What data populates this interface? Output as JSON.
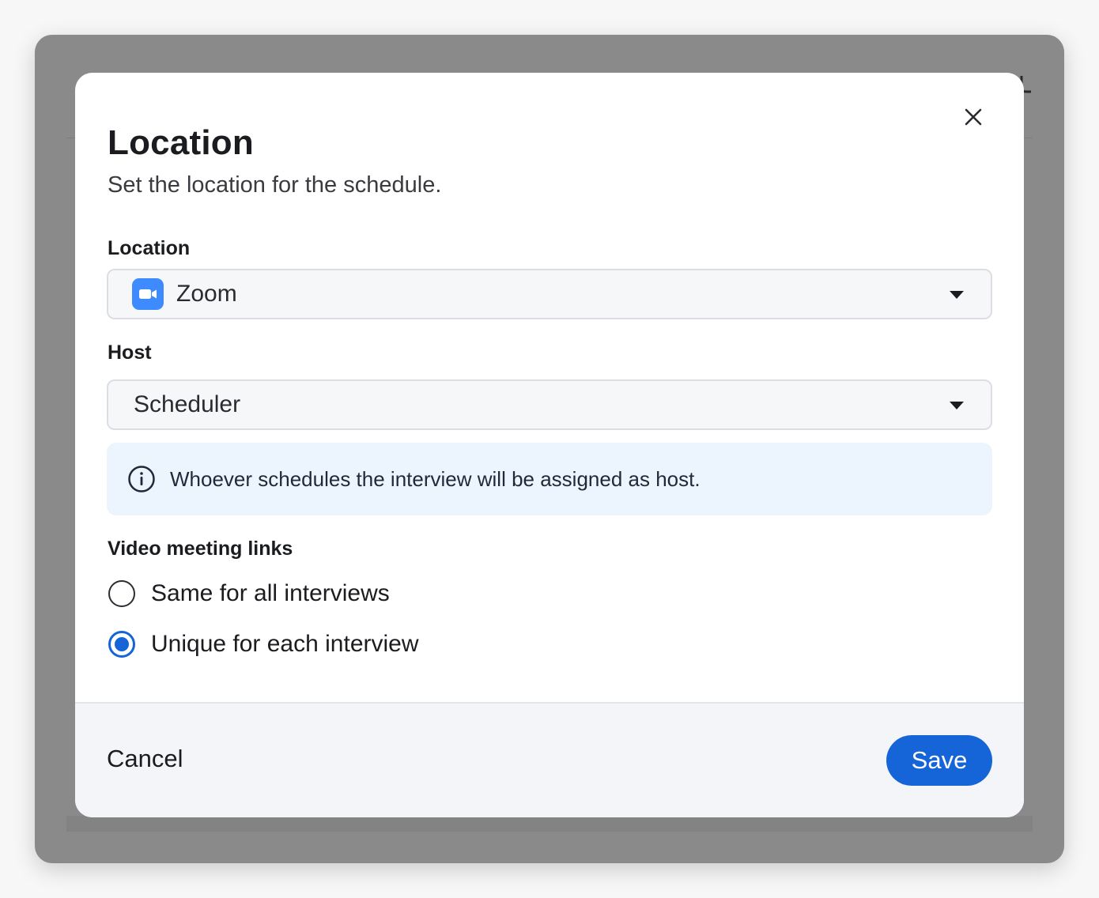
{
  "modal": {
    "title": "Location",
    "subtitle": "Set the location for the schedule."
  },
  "location": {
    "label": "Location",
    "selected": "Zoom",
    "icon": "zoom-video-icon",
    "icon_color": "#3e8bff"
  },
  "host": {
    "label": "Host",
    "selected": "Scheduler"
  },
  "info": {
    "icon": "info-icon",
    "text": "Whoever schedules the interview will be assigned as host."
  },
  "video_links": {
    "label": "Video meeting links",
    "options": [
      {
        "label": "Same for all interviews",
        "checked": false
      },
      {
        "label": "Unique for each interview",
        "checked": true
      }
    ]
  },
  "footer": {
    "cancel_label": "Cancel",
    "save_label": "Save"
  },
  "colors": {
    "accent": "#1565d8",
    "info_bg": "#ecf4fd",
    "overlay": "#8a8a8a"
  }
}
